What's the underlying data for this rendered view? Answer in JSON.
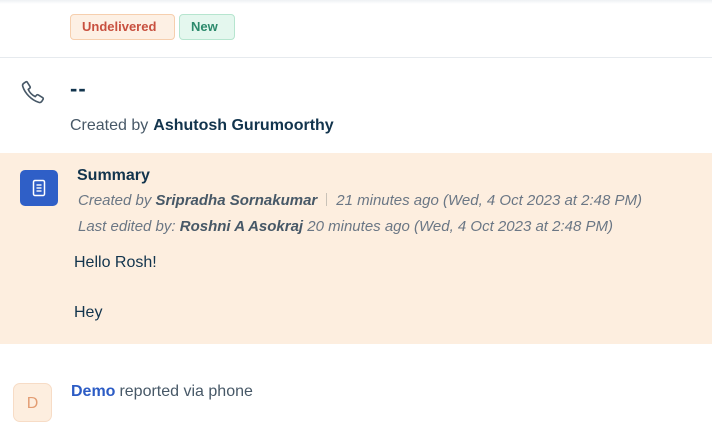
{
  "status_badges": {
    "delivery": "Undelivered",
    "state": "New"
  },
  "call": {
    "icon": "phone-icon",
    "title": "--",
    "created_by_label": "Created by",
    "created_by_name": "Ashutosh Gurumoorthy"
  },
  "summary": {
    "icon": "note-icon",
    "icon_bg": "#2f5fc7",
    "title": "Summary",
    "created_by_label": "Created by",
    "created_by_name": "Sripradha Sornakumar",
    "created_time": "21 minutes ago (Wed, 4 Oct 2023 at 2:48 PM)",
    "edited_by_label": "Last edited by:",
    "edited_by_name": "Roshni A Asokraj",
    "edited_time": "20 minutes ago (Wed, 4 Oct 2023 at 2:48 PM)",
    "body_lines": [
      "Hello Rosh!",
      "Hey"
    ],
    "background": "#fdeedf"
  },
  "activity": {
    "avatar_initial": "D",
    "reporter_name": "Demo",
    "reporter_text": "reported via phone"
  }
}
